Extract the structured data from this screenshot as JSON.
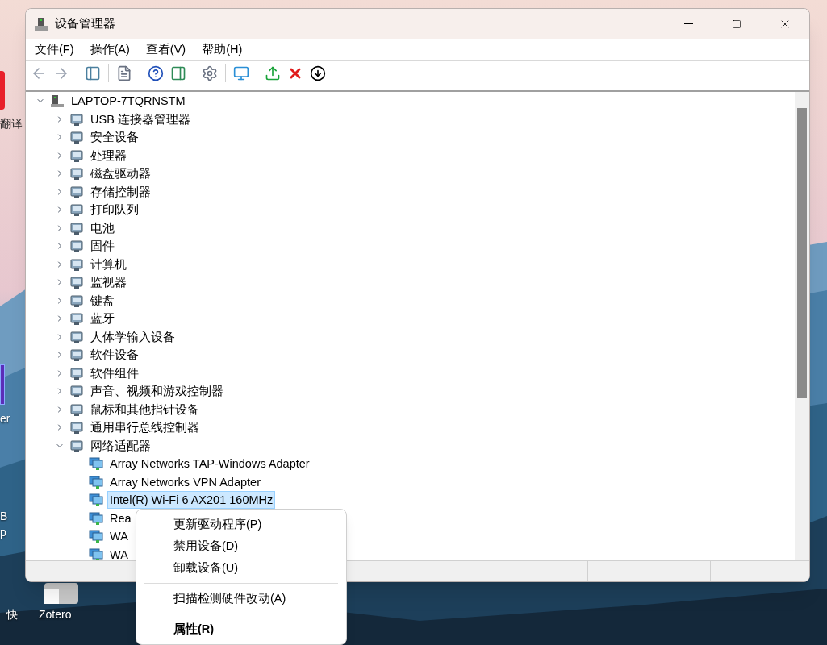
{
  "desktop_icons": [
    {
      "label": "翻译"
    },
    {
      "label": "er"
    },
    {
      "label": "B"
    },
    {
      "label": "p"
    },
    {
      "label": "快"
    },
    {
      "label": "Zotero"
    }
  ],
  "window": {
    "title": "设备管理器"
  },
  "menu_bar": [
    {
      "label": "文件(F)"
    },
    {
      "label": "操作(A)"
    },
    {
      "label": "查看(V)"
    },
    {
      "label": "帮助(H)"
    }
  ],
  "tree": {
    "label": "LAPTOP-7TQRNSTM",
    "expanded": true,
    "selected": false,
    "children": [
      {
        "label": "USB 连接器管理器",
        "expanded": false,
        "selected": false
      },
      {
        "label": "安全设备",
        "expanded": false,
        "selected": false
      },
      {
        "label": "处理器",
        "expanded": false,
        "selected": false
      },
      {
        "label": "磁盘驱动器",
        "expanded": false,
        "selected": false
      },
      {
        "label": "存储控制器",
        "expanded": false,
        "selected": false
      },
      {
        "label": "打印队列",
        "expanded": false,
        "selected": false
      },
      {
        "label": "电池",
        "expanded": false,
        "selected": false
      },
      {
        "label": "固件",
        "expanded": false,
        "selected": false
      },
      {
        "label": "计算机",
        "expanded": false,
        "selected": false
      },
      {
        "label": "监视器",
        "expanded": false,
        "selected": false
      },
      {
        "label": "键盘",
        "expanded": false,
        "selected": false
      },
      {
        "label": "蓝牙",
        "expanded": false,
        "selected": false
      },
      {
        "label": "人体学输入设备",
        "expanded": false,
        "selected": false
      },
      {
        "label": "软件设备",
        "expanded": false,
        "selected": false
      },
      {
        "label": "软件组件",
        "expanded": false,
        "selected": false
      },
      {
        "label": "声音、视频和游戏控制器",
        "expanded": false,
        "selected": false
      },
      {
        "label": "鼠标和其他指针设备",
        "expanded": false,
        "selected": false
      },
      {
        "label": "通用串行总线控制器",
        "expanded": false,
        "selected": false
      },
      {
        "label": "网络适配器",
        "expanded": true,
        "selected": false,
        "children": [
          {
            "label": "Array Networks TAP-Windows Adapter",
            "selected": false
          },
          {
            "label": "Array Networks VPN Adapter",
            "selected": false
          },
          {
            "label": "Intel(R) Wi-Fi 6 AX201 160MHz",
            "selected": true
          },
          {
            "label": "Rea",
            "selected": false
          },
          {
            "label": "WA",
            "selected": false
          },
          {
            "label": "WA",
            "selected": false
          }
        ]
      }
    ]
  },
  "context_menu": {
    "items": [
      {
        "kind": "item",
        "label": "更新驱动程序(P)",
        "bold": false
      },
      {
        "kind": "item",
        "label": "禁用设备(D)",
        "bold": false
      },
      {
        "kind": "item",
        "label": "卸载设备(U)",
        "bold": false
      },
      {
        "kind": "separator"
      },
      {
        "kind": "item",
        "label": "扫描检测硬件改动(A)",
        "bold": false
      },
      {
        "kind": "separator"
      },
      {
        "kind": "item",
        "label": "属性(R)",
        "bold": true
      }
    ]
  }
}
